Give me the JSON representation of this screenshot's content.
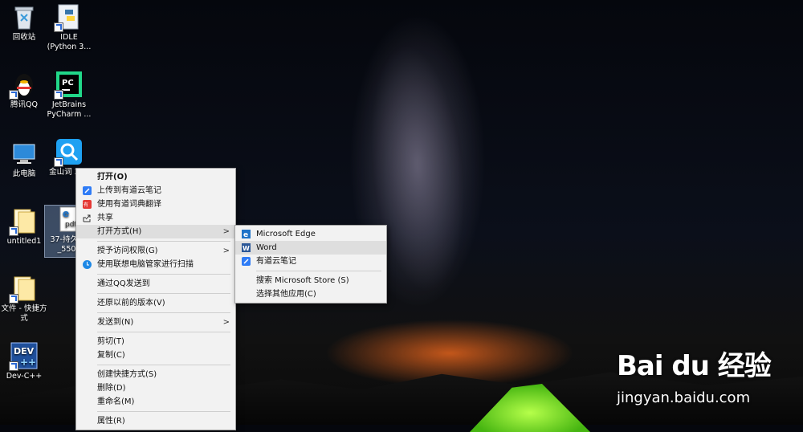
{
  "desktop": {
    "icons": [
      {
        "label": "回收站"
      },
      {
        "label": "IDLE (Python 3..."
      },
      {
        "label": "腾讯QQ"
      },
      {
        "label": "JetBrains PyCharm ..."
      },
      {
        "label": "此电脑"
      },
      {
        "label": "金山词 201"
      },
      {
        "label": "untitled1"
      },
      {
        "label": "37-持久 块_5507"
      },
      {
        "label": "文件 - 快捷方式"
      },
      {
        "label": "Dev-C++"
      }
    ],
    "pdf_badge": "pdf"
  },
  "context_menu": {
    "items": [
      {
        "label": "打开(O)"
      },
      {
        "label": "上传到有道云笔记"
      },
      {
        "label": "使用有道词典翻译"
      },
      {
        "label": "共享"
      },
      {
        "label": "打开方式(H)"
      },
      {
        "label": "授予访问权限(G)"
      },
      {
        "label": "使用联想电脑管家进行扫描"
      },
      {
        "label": "通过QQ发送到"
      },
      {
        "label": "还原以前的版本(V)"
      },
      {
        "label": "发送到(N)"
      },
      {
        "label": "剪切(T)"
      },
      {
        "label": "复制(C)"
      },
      {
        "label": "创建快捷方式(S)"
      },
      {
        "label": "删除(D)"
      },
      {
        "label": "重命名(M)"
      },
      {
        "label": "属性(R)"
      }
    ]
  },
  "submenu": {
    "items": [
      {
        "label": "Microsoft Edge"
      },
      {
        "label": "Word"
      },
      {
        "label": "有道云笔记"
      },
      {
        "label": "搜索 Microsoft Store (S)"
      },
      {
        "label": "选择其他应用(C)"
      }
    ]
  },
  "watermark": {
    "logo": "Bai du 经验",
    "url": "jingyan.baidu.com"
  },
  "colors": {
    "menu_bg": "#f2f2f2",
    "highlight": "#dedede",
    "youdao_blue": "#2f7cf6",
    "edge_blue": "#1e73c8",
    "word_blue": "#2b5797"
  }
}
